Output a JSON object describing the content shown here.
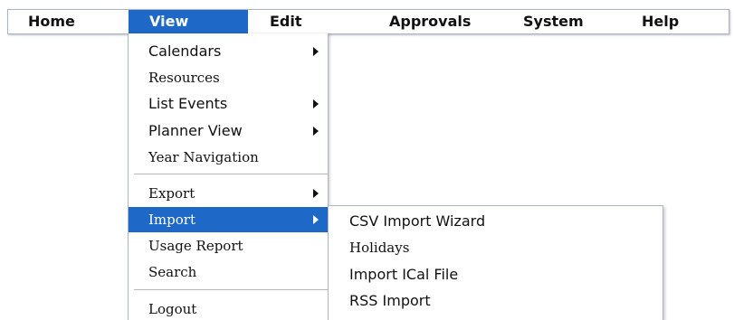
{
  "menubar": {
    "items": [
      {
        "label": "Home"
      },
      {
        "label": "View"
      },
      {
        "label": "Edit"
      },
      {
        "label": "Approvals"
      },
      {
        "label": "System"
      },
      {
        "label": "Help"
      }
    ],
    "active": "View"
  },
  "view_menu": {
    "items": [
      {
        "label": "Calendars",
        "has_submenu": true
      },
      {
        "label": "Resources",
        "has_submenu": false
      },
      {
        "label": "List Events",
        "has_submenu": true
      },
      {
        "label": "Planner View",
        "has_submenu": true
      },
      {
        "label": "Year Navigation",
        "has_submenu": false
      },
      {
        "label": "Export",
        "has_submenu": true
      },
      {
        "label": "Import",
        "has_submenu": true
      },
      {
        "label": "Usage Report",
        "has_submenu": false
      },
      {
        "label": "Search",
        "has_submenu": false
      },
      {
        "label": "Logout",
        "has_submenu": false
      }
    ],
    "active": "Import"
  },
  "import_submenu": {
    "items": [
      {
        "label": "CSV Import Wizard"
      },
      {
        "label": "Holidays"
      },
      {
        "label": "Import ICal File"
      },
      {
        "label": "RSS Import"
      }
    ]
  },
  "colors": {
    "highlight": "#1e68c8",
    "border": "#a9b6c8",
    "text": "#111111"
  }
}
